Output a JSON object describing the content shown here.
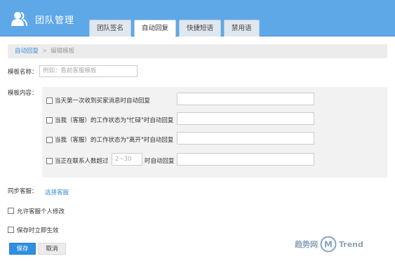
{
  "app": {
    "title": "团队管理"
  },
  "tabs": [
    {
      "label": "团队签名",
      "active": false
    },
    {
      "label": "自动回复",
      "active": true
    },
    {
      "label": "快捷短语",
      "active": false
    },
    {
      "label": "禁用语",
      "active": false
    }
  ],
  "breadcrumb": {
    "link": "自动回复",
    "separator": ">",
    "current": "编辑模板"
  },
  "template_name": {
    "label": "模板名称：",
    "placeholder": "例如：售前客服模板",
    "value": ""
  },
  "template_content": {
    "label": "模板内容：",
    "options": [
      {
        "text": "当天第一次收到买家消息时自动回复",
        "checked": false
      },
      {
        "text": "当我（客服）的工作状态为\"忙碌\"时自动回复",
        "checked": false
      },
      {
        "text": "当我（客服）的工作状态为\"离开\"时自动回复",
        "checked": false
      },
      {
        "text_prefix": "当正在联系人数超过",
        "count_placeholder": "2~30",
        "text_suffix": "时自动回复",
        "checked": false
      }
    ]
  },
  "sync": {
    "label": "同步客服：",
    "link": "选择客服"
  },
  "allow_edit": {
    "label": "允许客服个人修改",
    "checked": false
  },
  "apply_on_save": {
    "label": "保存时立即生效",
    "checked": false
  },
  "buttons": {
    "save": "保存",
    "cancel": "取消"
  },
  "watermark": {
    "text_cn": "趋势网",
    "text_en": "Trend",
    "logo_letter": "M"
  },
  "colors": {
    "header": "#5ea8e8",
    "accent": "#2f8fe0",
    "link": "#3b8fd8"
  }
}
